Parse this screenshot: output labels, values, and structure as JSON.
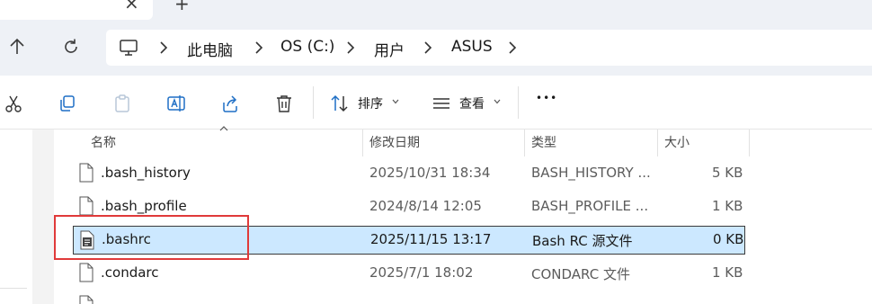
{
  "window": {
    "tab_close_glyph": "×",
    "new_tab_glyph": "+"
  },
  "address_bar": {
    "breadcrumbs": [
      "此电脑",
      "OS (C:)",
      "用户",
      "ASUS"
    ]
  },
  "toolbar": {
    "sort_label": "排序",
    "view_label": "查看",
    "more_glyph": "•••"
  },
  "file_list": {
    "columns": [
      "名称",
      "修改日期",
      "类型",
      "大小"
    ],
    "rows": [
      {
        "name": ".bash_history",
        "modified": "2025/10/31 18:34",
        "type": "BASH_HISTORY ...",
        "size": "5 KB"
      },
      {
        "name": ".bash_profile",
        "modified": "2024/8/14 12:05",
        "type": "BASH_PROFILE ...",
        "size": "1 KB"
      },
      {
        "name": ".bashrc",
        "modified": "2025/11/15 13:17",
        "type": "Bash RC 源文件",
        "size": "0 KB"
      },
      {
        "name": ".condarc",
        "modified": "2025/7/1 18:02",
        "type": "CONDARC 文件",
        "size": "1 KB"
      }
    ],
    "selected_index": 2
  },
  "colors": {
    "selection_bg": "#cce8ff",
    "highlight_border": "#e03a3a",
    "chrome_bg": "#eef1f6"
  }
}
